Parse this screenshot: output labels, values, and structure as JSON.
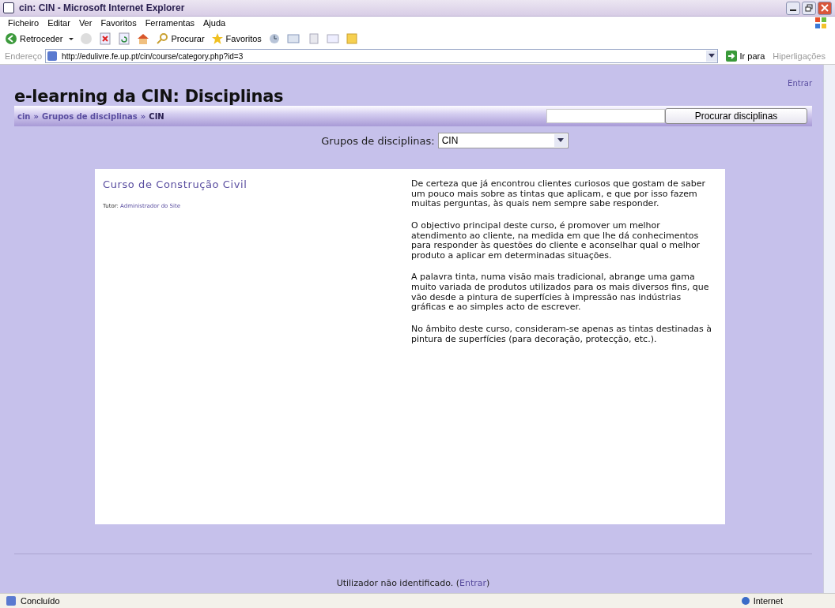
{
  "window": {
    "title": "cin: CIN - Microsoft Internet Explorer"
  },
  "menu": [
    "Ficheiro",
    "Editar",
    "Ver",
    "Favoritos",
    "Ferramentas",
    "Ajuda"
  ],
  "toolbar": {
    "back": "Retroceder",
    "search": "Procurar",
    "favorites": "Favoritos"
  },
  "address_bar": {
    "label": "Endereço",
    "url": "http://edulivre.fe.up.pt/cin/course/category.php?id=3",
    "go": "Ir para",
    "links": "Hiperligações"
  },
  "page": {
    "heading": "e-learning da CIN: Disciplinas",
    "login_link": "Entrar",
    "breadcrumb": {
      "separator": "»",
      "items": [
        "cin",
        "Grupos de disciplinas",
        "CIN"
      ]
    },
    "search_button": "Procurar disciplinas",
    "category": {
      "label": "Grupos de disciplinas:",
      "value": "CIN"
    },
    "course": {
      "name": "Curso de Construção Civil",
      "tutor_label": "Tutor:",
      "tutor": "Administrador do Site",
      "summary": [
        "De certeza que já encontrou clientes curiosos que gostam de saber um pouco mais sobre as tintas que aplicam, e que por isso fazem muitas perguntas, às quais nem sempre sabe responder.",
        "O objectivo principal deste curso, é promover um melhor atendimento ao cliente, na medida em que lhe dá conhecimentos para responder às questões do cliente e aconselhar qual o melhor produto a aplicar em determinadas situações.",
        "A palavra tinta, numa visão mais tradicional, abrange uma gama muito variada de produtos utilizados para os mais diversos fins, que vão desde a pintura de superfícies à impressão nas indústrias gráficas e ao simples acto de escrever.",
        "No âmbito deste curso, consideram-se apenas as tintas destinadas à pintura de superfícies (para decoração, protecção, etc.)."
      ]
    },
    "footer": {
      "text": "Utilizador não identificado. (",
      "link": "Entrar",
      "after": ")"
    }
  },
  "status_bar": {
    "text": "Concluído",
    "zone": "Internet"
  }
}
